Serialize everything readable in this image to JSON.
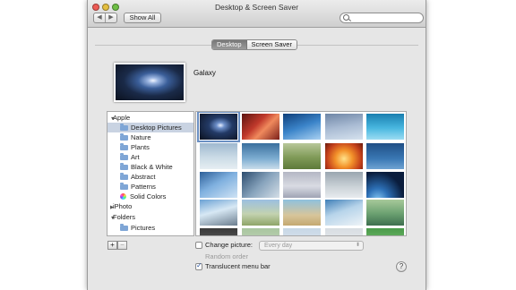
{
  "window": {
    "title": "Desktop & Screen Saver"
  },
  "toolbar": {
    "back": "◀",
    "forward": "▶",
    "show_all": "Show All",
    "search_placeholder": ""
  },
  "tabs": [
    {
      "label": "Desktop",
      "active": true
    },
    {
      "label": "Screen Saver",
      "active": false
    }
  ],
  "preview": {
    "name": "Galaxy"
  },
  "sidebar": {
    "items": [
      {
        "label": "Apple",
        "kind": "group",
        "expanded": true
      },
      {
        "label": "Desktop Pictures",
        "kind": "folder",
        "selected": true
      },
      {
        "label": "Nature",
        "kind": "folder"
      },
      {
        "label": "Plants",
        "kind": "folder"
      },
      {
        "label": "Art",
        "kind": "folder"
      },
      {
        "label": "Black & White",
        "kind": "folder"
      },
      {
        "label": "Abstract",
        "kind": "folder"
      },
      {
        "label": "Patterns",
        "kind": "folder"
      },
      {
        "label": "Solid Colors",
        "kind": "colors"
      },
      {
        "label": "iPhoto",
        "kind": "group",
        "expanded": false
      },
      {
        "label": "Folders",
        "kind": "group",
        "expanded": true
      },
      {
        "label": "Pictures",
        "kind": "folder"
      }
    ]
  },
  "buttons": {
    "add": "+",
    "remove": "−",
    "help": "?"
  },
  "options": {
    "change_picture": {
      "label": "Change picture:",
      "checked": false
    },
    "interval": {
      "value": "Every day"
    },
    "random_order": {
      "label": "Random order",
      "checked": false,
      "disabled": true
    },
    "translucent": {
      "label": "Translucent menu bar",
      "checked": true
    }
  },
  "colors": {
    "selection": "#c9d3e2",
    "accent": "#2a55a0"
  }
}
